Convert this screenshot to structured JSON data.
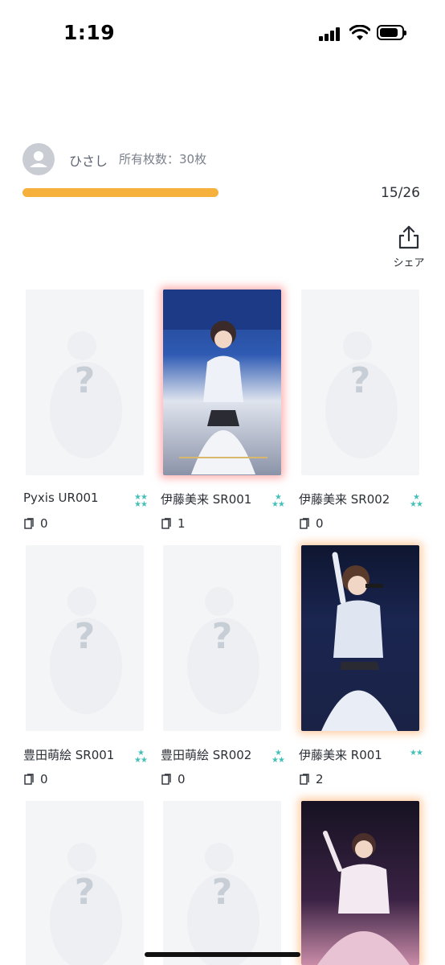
{
  "status_bar": {
    "time": "1:19"
  },
  "profile": {
    "username": "ひさし",
    "owned_label": "所有枚数：30枚",
    "progress_text": "15/26",
    "progress_fraction": 0.577
  },
  "share": {
    "label": "シェア",
    "icon": "share-icon"
  },
  "cards": [
    {
      "name": "Pyxis UR001",
      "qty": "0",
      "owned": false,
      "rarity_icon": "two-stars-icon"
    },
    {
      "name": "伊藤美来 SR001",
      "qty": "1",
      "owned": true,
      "rarity_icon": "two-stars-icon"
    },
    {
      "name": "伊藤美来 SR002",
      "qty": "0",
      "owned": false,
      "rarity_icon": "two-stars-icon"
    },
    {
      "name": "豊田萌絵 SR001",
      "qty": "0",
      "owned": false,
      "rarity_icon": "two-stars-icon"
    },
    {
      "name": "豊田萌絵 SR002",
      "qty": "0",
      "owned": false,
      "rarity_icon": "two-stars-icon"
    },
    {
      "name": "伊藤美来 R001",
      "qty": "2",
      "owned": true,
      "rarity_icon": "two-stars-icon"
    },
    {
      "name": "",
      "qty": "",
      "owned": false
    },
    {
      "name": "",
      "qty": "",
      "owned": false
    },
    {
      "name": "",
      "qty": "",
      "owned": true
    }
  ],
  "colors": {
    "progress": "#f6b13d",
    "rarity": "#45c0b8",
    "sr_glow": "#ff7878",
    "r_glow": "#ffaa64"
  }
}
